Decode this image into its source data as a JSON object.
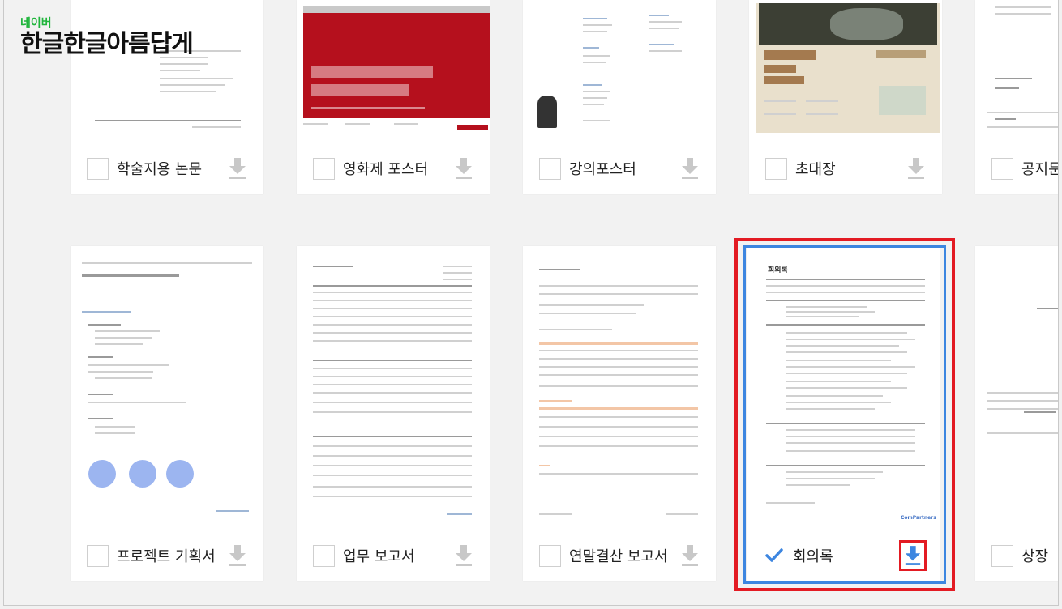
{
  "logo": {
    "brand": "네이버",
    "title": "한글한글아름답게"
  },
  "templates_row1": [
    {
      "label": "학술지용 논문",
      "checked": false
    },
    {
      "label": "영화제 포스터",
      "checked": false
    },
    {
      "label": "강의포스터",
      "checked": false
    },
    {
      "label": "초대장",
      "checked": false
    },
    {
      "label": "공지문",
      "checked": false
    }
  ],
  "templates_row2": [
    {
      "label": "프로젝트 기획서",
      "checked": false
    },
    {
      "label": "업무 보고서",
      "checked": false
    },
    {
      "label": "연말결산 보고서",
      "checked": false
    },
    {
      "label": "회의록",
      "checked": true
    },
    {
      "label": "상장",
      "checked": false
    }
  ],
  "thumbnails": {
    "meeting_title": "회의록",
    "meeting_brand": "ComPartners"
  },
  "icons": {
    "checkbox": "checkbox-icon",
    "check": "checkmark-icon",
    "download": "download-icon"
  },
  "colors": {
    "accent_blue": "#3d86e0",
    "highlight_red": "#e31b23",
    "download_gray": "#c8c8c8",
    "poster_red": "#b5101d",
    "logo_green": "#1fb53b"
  }
}
